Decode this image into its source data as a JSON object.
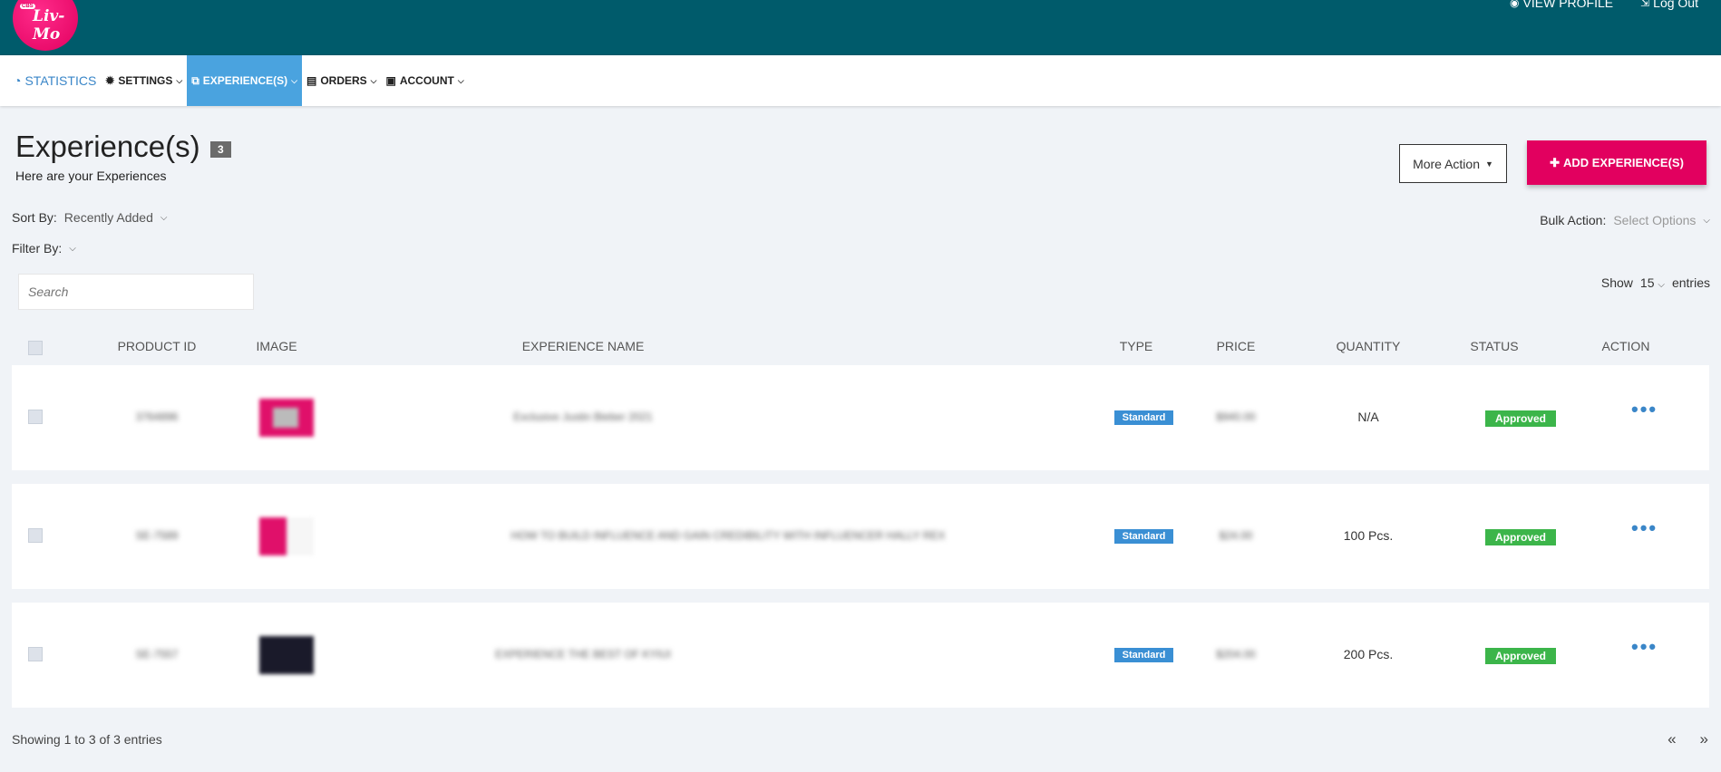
{
  "header": {
    "logo_text": "Liv-Mo",
    "logo_mini": "CBS",
    "view_profile": "VIEW PROFILE",
    "log_out": "Log Out"
  },
  "nav": {
    "statistics": "STATISTICS",
    "settings": "SETTINGS",
    "experiences": "EXPERIENCE(S)",
    "orders": "ORDERS",
    "account": "ACCOUNT"
  },
  "page": {
    "title": "Experience(s)",
    "count": "3",
    "subtitle": "Here are your Experiences",
    "more_action": "More Action",
    "add_label": "ADD EXPERIENCE(S)"
  },
  "controls": {
    "sort_label": "Sort By:",
    "sort_value": "Recently Added",
    "filter_label": "Filter By:",
    "bulk_label": "Bulk Action:",
    "bulk_value": "Select Options",
    "search_placeholder": "Search",
    "show_label": "Show",
    "show_value": "15",
    "entries_label": "entries"
  },
  "table": {
    "columns": [
      "PRODUCT ID",
      "IMAGE",
      "EXPERIENCE NAME",
      "TYPE",
      "PRICE",
      "QUANTITY",
      "STATUS",
      "ACTION"
    ],
    "rows": [
      {
        "id": "3764896",
        "name": "Exclusive Justin Bieber 2021",
        "type": "Standard",
        "price": "$940.00",
        "quantity": "N/A",
        "status": "Approved",
        "thumb_color": "#e0106a"
      },
      {
        "id": "SE-7589",
        "name": "HOW TO BUILD INFLUENCE AND GAIN CREDIBILITY WITH INFLUENCER HALLY REX",
        "type": "Standard",
        "price": "$24.00",
        "quantity": "100 Pcs.",
        "status": "Approved",
        "thumb_color": "#e0106a"
      },
      {
        "id": "SE-7557",
        "name": "EXPERIENCE THE BEST OF KYIUI",
        "type": "Standard",
        "price": "$204.00",
        "quantity": "200 Pcs.",
        "status": "Approved",
        "thumb_color": "#1a1a2a"
      }
    ]
  },
  "footer": {
    "showing": "Showing 1 to 3 of 3 entries",
    "prev": "«",
    "next": "»"
  },
  "colors": {
    "topbar": "#005b6b",
    "accent": "#e2005f",
    "nav_active": "#4aa3df",
    "standard": "#3a8fd4",
    "approved": "#3cb54a"
  }
}
